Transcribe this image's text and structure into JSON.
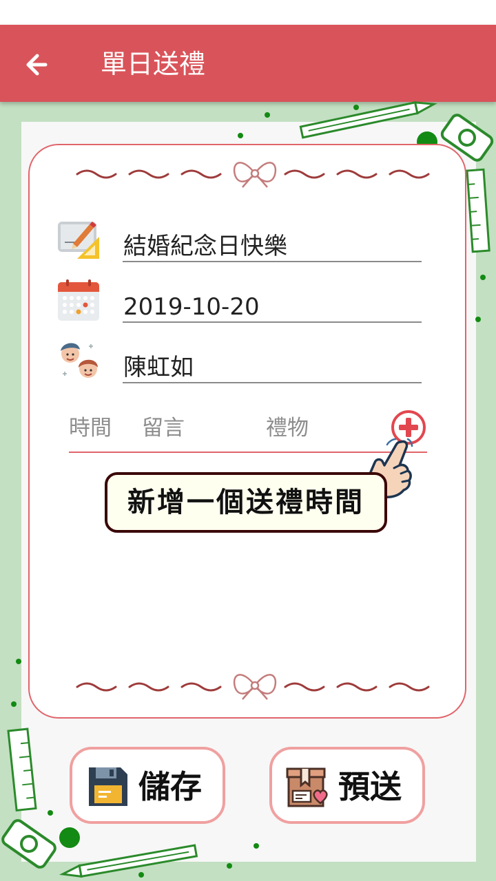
{
  "header": {
    "title": "單日送禮",
    "back_icon": "arrow-left-icon",
    "color": "#d9545a"
  },
  "form": {
    "occasion": {
      "value": "結婚紀念日快樂",
      "icon": "edit-blueprint-icon"
    },
    "date": {
      "value": "2019-10-20",
      "icon": "calendar-icon"
    },
    "recipient": {
      "value": "陳虹如",
      "icon": "couple-icon"
    }
  },
  "table": {
    "col_time": "時間",
    "col_message": "留言",
    "col_gift": "禮物",
    "add_icon": "plus-circle-icon",
    "rows": []
  },
  "hint": {
    "text": "新增一個送禮時間",
    "icon": "pointing-hand-icon"
  },
  "actions": {
    "save": {
      "label": "儲存",
      "icon": "floppy-disk-icon"
    },
    "preview": {
      "label": "預送",
      "icon": "gift-box-icon"
    }
  },
  "colors": {
    "accent": "#d9545a",
    "background": "#c3e0c2",
    "button_border": "#f0a0a0"
  }
}
